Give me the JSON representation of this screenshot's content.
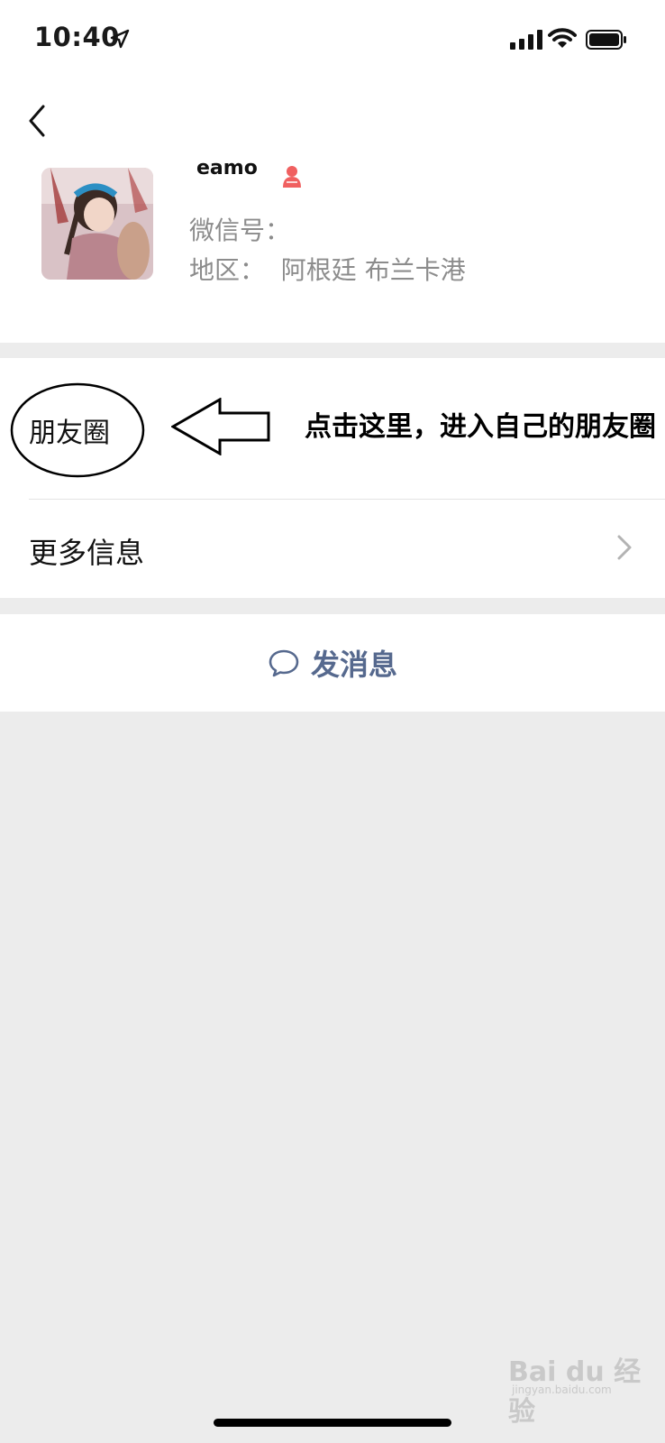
{
  "status_bar": {
    "time": "10:40",
    "icons": [
      "location-arrow-icon",
      "signal-icon",
      "wifi-icon",
      "battery-icon"
    ]
  },
  "profile": {
    "nickname": "eamo",
    "gender_icon": "female-icon",
    "gender_color": "#f06060",
    "wechat_id_label": "微信号：",
    "region_text": "地区：  阿根廷 布兰卡港"
  },
  "menu": {
    "moments_label": "朋友圈",
    "more_info_label": "更多信息"
  },
  "annotation": {
    "text": "点击这里，进入自己的朋友圈"
  },
  "actions": {
    "message_label": "发消息",
    "message_color": "#56698e"
  },
  "watermark": {
    "main": "Bai du 经验",
    "sub": "jingyan.baidu.com"
  }
}
